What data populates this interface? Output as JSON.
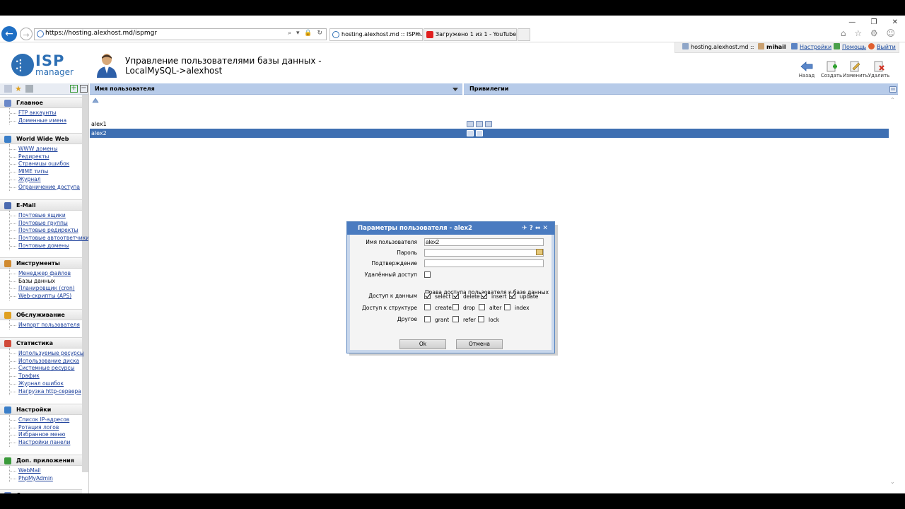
{
  "browser": {
    "url": "https://hosting.alexhost.md/ispmgr",
    "tabs": [
      {
        "label": "hosting.alexhost.md :: ISPm..."
      },
      {
        "label": "Загружено 1 из 1 - YouTube"
      }
    ]
  },
  "header": {
    "logo_isp": "ISP",
    "logo_manager": "manager",
    "title_line1": "Управление пользователями базы данных -",
    "title_line2": "LocalMySQL->alexhost"
  },
  "userbar": {
    "host": "hosting.alexhost.md ::",
    "user": "mihail",
    "settings": "Настройки",
    "help": "Помощь",
    "logout": "Выйти"
  },
  "toolbar": {
    "back": "Назад",
    "create": "Создать",
    "edit": "Изменить",
    "delete": "Удалить"
  },
  "sidebar": {
    "groups": [
      {
        "title": "Главное",
        "items": [
          "FTP аккаунты",
          "Доменные имена"
        ]
      },
      {
        "title": "World Wide Web",
        "items": [
          "WWW домены",
          "Редиректы",
          "Страницы ошибок",
          "MIME типы",
          "Журнал",
          "Ограничение доступа"
        ]
      },
      {
        "title": "E-Mail",
        "items": [
          "Почтовые ящики",
          "Почтовые группы",
          "Почтовые редиректы",
          "Почтовые автоответчики",
          "Почтовые домены"
        ]
      },
      {
        "title": "Инструменты",
        "items": [
          "Менеджер файлов",
          "Базы данных",
          "Планировщик (cron)",
          "Web-скрипты (APS)"
        ]
      },
      {
        "title": "Обслуживание",
        "items": [
          "Импорт пользователя"
        ]
      },
      {
        "title": "Статистика",
        "items": [
          "Используемые ресурсы",
          "Использование диска",
          "Системные ресурсы",
          "Трафик",
          "Журнал ошибок",
          "Нагрузка http-сервера"
        ]
      },
      {
        "title": "Настройки",
        "items": [
          "Список IP-адресов",
          "Ротация логов",
          "Избранное меню",
          "Настройки панели"
        ]
      },
      {
        "title": "Доп. приложения",
        "items": [
          "WebMail",
          "PhpMyAdmin"
        ]
      },
      {
        "title": "Справка",
        "items": []
      }
    ]
  },
  "table": {
    "col_username": "Имя пользователя",
    "col_privileges": "Привилегии",
    "rows": [
      {
        "name": "alex1",
        "priv_icons": 3,
        "selected": false
      },
      {
        "name": "alex2",
        "priv_icons": 2,
        "selected": true
      }
    ]
  },
  "dialog": {
    "title": "Параметры пользователя - alex2",
    "username_label": "Имя пользователя",
    "username_value": "alex2",
    "password_label": "Пароль",
    "password_value": "",
    "confirm_label": "Подтверждение",
    "confirm_value": "",
    "remote_label": "Удалённый доступ",
    "remote_checked": false,
    "rights_heading": "Права доступа пользователя к базе данных",
    "data_label": "Доступ к данным",
    "data_opts": [
      {
        "name": "select",
        "checked": true
      },
      {
        "name": "delete",
        "checked": true
      },
      {
        "name": "insert",
        "checked": true
      },
      {
        "name": "update",
        "checked": true
      }
    ],
    "struct_label": "Доступ к структуре",
    "struct_opts": [
      {
        "name": "create",
        "checked": false
      },
      {
        "name": "drop",
        "checked": false
      },
      {
        "name": "alter",
        "checked": false
      },
      {
        "name": "index",
        "checked": false
      }
    ],
    "other_label": "Другое",
    "other_opts": [
      {
        "name": "grant",
        "checked": false
      },
      {
        "name": "refer",
        "checked": false
      },
      {
        "name": "lock",
        "checked": false
      }
    ],
    "ok_label": "Ok",
    "cancel_label": "Отмена"
  },
  "colors": {
    "header_blue": "#b7cbe9",
    "selection": "#3e6fb2",
    "dialog_title": "#4a7bc0",
    "logo": "#2d6fb4"
  }
}
